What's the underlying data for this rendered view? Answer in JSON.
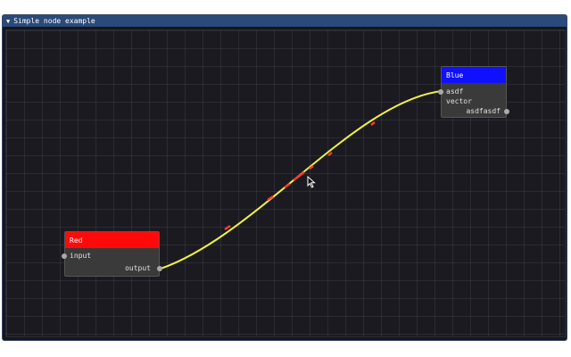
{
  "window": {
    "title": "Simple node example",
    "collapse_icon": "triangle-down-icon"
  },
  "nodes": {
    "red": {
      "title": "Red",
      "color": "#ff0000",
      "inputs": [
        "input"
      ],
      "outputs": [
        "output"
      ]
    },
    "blue": {
      "title": "Blue",
      "color": "#0000ff",
      "inputs": [
        "asdf",
        "vector"
      ],
      "outputs": [
        "asdfasdf"
      ]
    }
  },
  "link": {
    "from": "Red.output",
    "to": "Blue.asdf",
    "color": "#ffff40",
    "highlight_color": "#ff3030"
  },
  "cursor_icon": "arrow-cursor-icon"
}
